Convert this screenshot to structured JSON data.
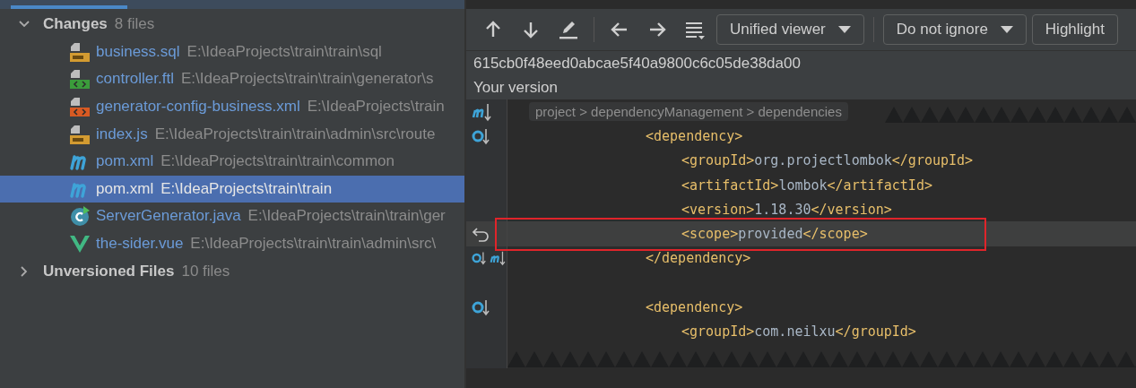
{
  "changes_tree": [
    {
      "label": "Changes",
      "count": "8 files",
      "expanded": true,
      "children": [
        {
          "name": "business.sql",
          "path": "E:\\IdeaProjects\\train\\train\\sql",
          "kind": "sql",
          "selected": false
        },
        {
          "name": "controller.ftl",
          "path": "E:\\IdeaProjects\\train\\train\\generator\\s",
          "kind": "ftl",
          "selected": false
        },
        {
          "name": "generator-config-business.xml",
          "path": "E:\\IdeaProjects\\train",
          "kind": "xml",
          "selected": false
        },
        {
          "name": "index.js",
          "path": "E:\\IdeaProjects\\train\\train\\admin\\src\\route",
          "kind": "js",
          "selected": false
        },
        {
          "name": "pom.xml",
          "path": "E:\\IdeaProjects\\train\\train\\common",
          "kind": "maven",
          "selected": false
        },
        {
          "name": "pom.xml",
          "path": "E:\\IdeaProjects\\train\\train",
          "kind": "maven",
          "selected": true
        },
        {
          "name": "ServerGenerator.java",
          "path": "E:\\IdeaProjects\\train\\train\\ger",
          "kind": "java",
          "selected": false
        },
        {
          "name": "the-sider.vue",
          "path": "E:\\IdeaProjects\\train\\train\\admin\\src\\",
          "kind": "vue",
          "selected": false
        }
      ]
    },
    {
      "label": "Unversioned Files",
      "count": "10 files",
      "expanded": false
    }
  ],
  "toolbar": {
    "dropdowns": [
      "Unified viewer",
      "Do not ignore",
      "Highlight"
    ]
  },
  "revision": "615cb0f48eed0abcae5f40a9800c6c05de38da00",
  "version_label": "Your version",
  "breadcrumb": "project > dependencyManagement > dependencies",
  "code_lines": [
    {
      "kind": "open",
      "markers": [
        {
          "kind": "override"
        }
      ],
      "changed": false,
      "tag": "<dependency>"
    },
    {
      "kind": "element",
      "changed": false,
      "tag": "<groupId>",
      "value": "org.projectlombok",
      "close": "</groupId>"
    },
    {
      "kind": "element",
      "changed": false,
      "tag": "<artifactId>",
      "value": "lombok",
      "close": "</artifactId>"
    },
    {
      "kind": "element",
      "changed": false,
      "tag": "<version>",
      "value": "1.18.30",
      "close": "</version>"
    },
    {
      "kind": "element",
      "markers": [
        {
          "kind": "revert"
        }
      ],
      "changed": true,
      "tag": "<scope>",
      "value": "provided",
      "close": "</scope>"
    },
    {
      "kind": "open",
      "markers": [
        {
          "kind": "override"
        },
        {
          "kind": "maven"
        }
      ],
      "changed": false,
      "tag": "</dependency>"
    },
    {
      "kind": "blank",
      "changed": false
    },
    {
      "kind": "open",
      "markers": [
        {
          "kind": "override"
        }
      ],
      "changed": false,
      "tag": "<dependency>"
    },
    {
      "kind": "element",
      "changed": false,
      "tag": "<groupId>",
      "value": "com.neilxu",
      "close": "</groupId>"
    }
  ]
}
